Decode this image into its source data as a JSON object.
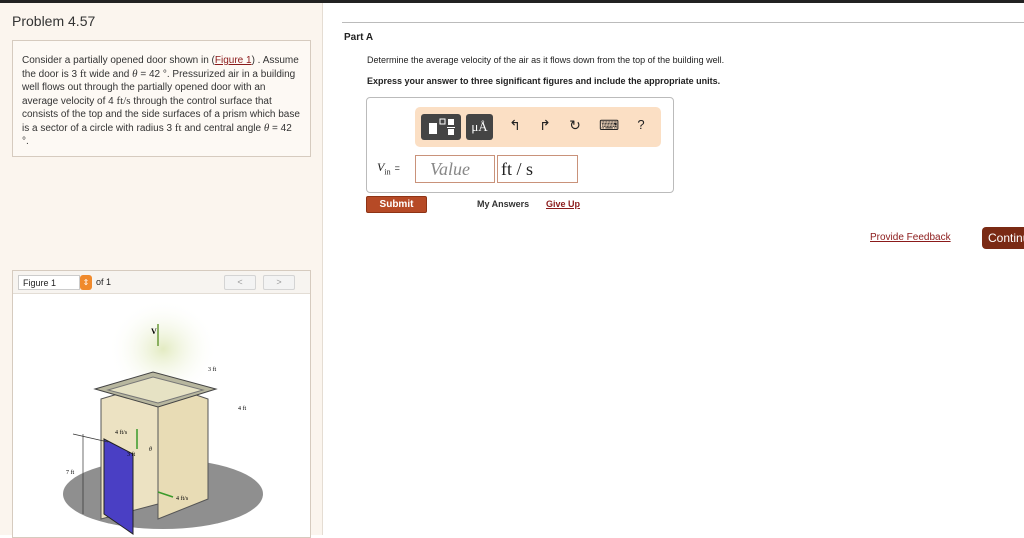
{
  "problem": {
    "title": "Problem 4.57",
    "text_1": "Consider a partially opened door shown in (",
    "figure_link": "Figure 1",
    "text_2": ") . Assume the door is 3 ",
    "unit_ft": "ft",
    "text_3": " wide and ",
    "theta": "θ",
    "text_4": " = 42 °. Pressurized air in a building well flows out through the partially opened door with an average velocity of 4 ",
    "unit_fts": "ft/s",
    "text_5": " through the control surface that consists of the top and the side surfaces of a prism which base is a sector of a circle with radius 3 ",
    "text_6": " and central angle ",
    "text_7": " = 42 °."
  },
  "figure": {
    "selector": "Figure 1",
    "of_label": "of 1",
    "prev": "<",
    "next": ">",
    "labels": {
      "v": "V",
      "w": "3 ft",
      "d": "4 ft",
      "vel": "4 ft/s",
      "door": "3 ft",
      "h": "7 ft",
      "out": "4 ft/s",
      "theta": "θ"
    }
  },
  "part": {
    "title": "Part A",
    "question": "Determine the average velocity of the air as it flows down from the top of the building well.",
    "instruction": "Express your answer to three significant figures and include the appropriate units."
  },
  "answer": {
    "toolbar": {
      "templates": "templates-icon",
      "units": "μÅ",
      "undo": "↰",
      "redo": "↱",
      "reset": "↻",
      "keyboard": "⌨",
      "help": "?"
    },
    "var": "V",
    "var_sub": "in",
    "eq": "=",
    "value_placeholder": "Value",
    "unit": "ft / s"
  },
  "actions": {
    "submit": "Submit",
    "my_answers": "My Answers",
    "give_up": "Give Up",
    "feedback": "Provide Feedback",
    "continue": "Continue"
  }
}
